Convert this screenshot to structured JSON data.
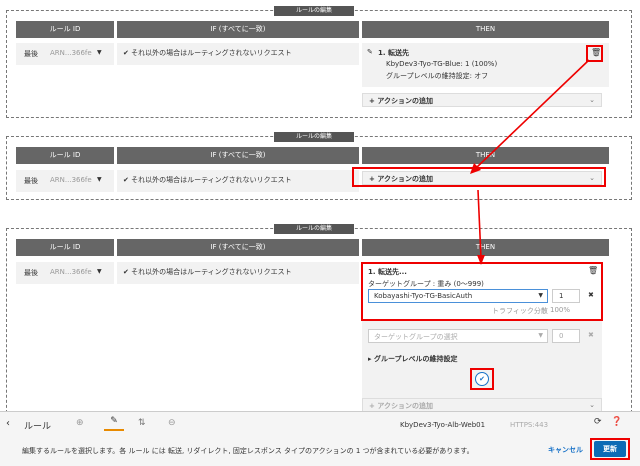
{
  "panel_title": "ルールの編集",
  "headers": {
    "rule_id": "ルール ID",
    "if": "IF (すべてに一致)",
    "then": "THEN"
  },
  "rule_label": "最後",
  "arn": "ARN...366fe",
  "condition": "それ以外の場合はルーティングされないリクエスト",
  "panel1": {
    "action_title": "1. 転送先",
    "target": "KbyDev3-Tyo-TG-Blue: 1 (100%)",
    "stickiness": "グループレベルの維持設定: オフ"
  },
  "add_action": "アクションの追加",
  "panel3": {
    "action_title": "1. 転送先...",
    "target_label": "ターゲットグループ : 重み (0〜999)",
    "target_value": "Kobayashi-Tyo-TG-BasicAuth",
    "weight": "1",
    "traffic": "トラフィック分散",
    "traffic_pct": "100%",
    "select_placeholder": "ターゲットグループの選択",
    "weight2": "0",
    "group_stickiness": "グループレベルの維持設定"
  },
  "toolbar": {
    "back": "ルール",
    "alb": "KbyDev3-Tyo-Alb-Web01",
    "listener": "HTTPS:443"
  },
  "footer": {
    "message": "編集するルールを選択します。各 ルール には 転送, リダイレクト, 固定レスポンス タイプのアクションの 1 つが含まれている必要があります。",
    "cancel": "キャンセル",
    "update": "更新"
  },
  "colors": {
    "red": "#e00000",
    "header": "#666666",
    "update_btn": "#0d6bb5"
  }
}
